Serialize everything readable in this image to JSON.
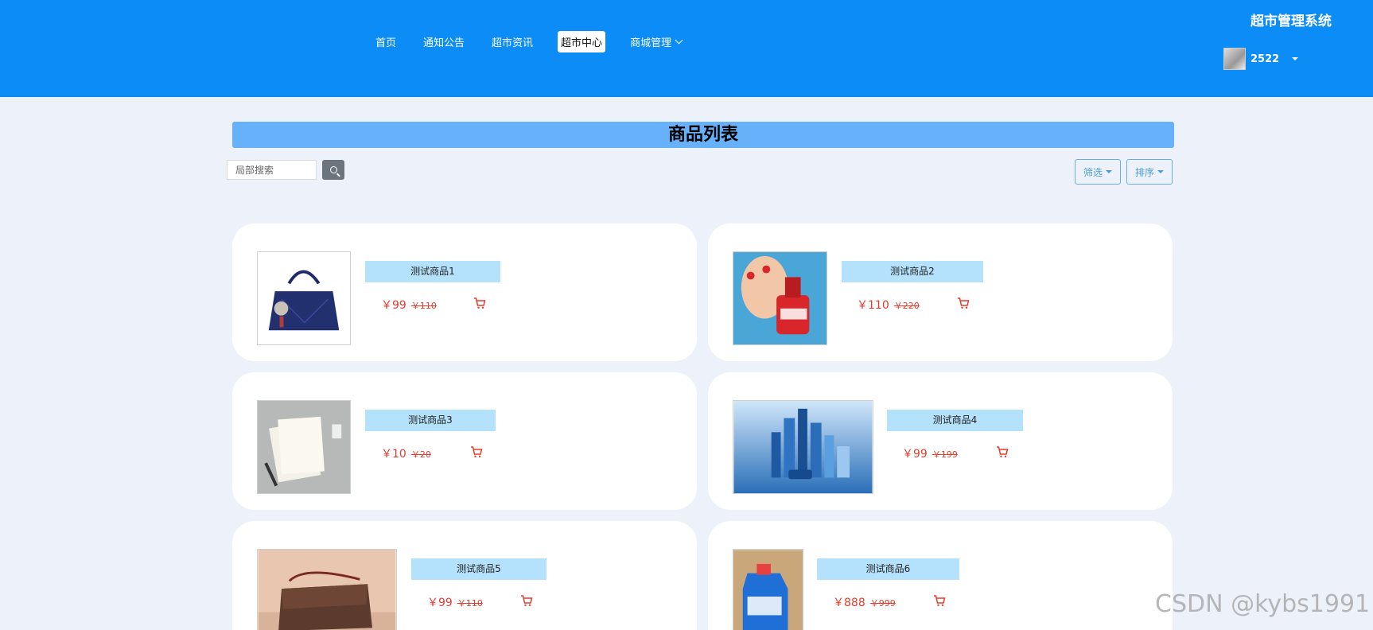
{
  "header": {
    "nav": [
      {
        "label": "首页",
        "active": false
      },
      {
        "label": "通知公告",
        "active": false
      },
      {
        "label": "超市资讯",
        "active": false
      },
      {
        "label": "超市中心",
        "active": true
      },
      {
        "label": "商城管理",
        "active": false,
        "dropdown": true
      }
    ],
    "system_title": "超市管理系统",
    "user": {
      "name": "2522"
    }
  },
  "main": {
    "title": "商品列表",
    "search": {
      "placeholder": "局部搜索",
      "value": ""
    },
    "filter_label": "筛选",
    "sort_label": "排序",
    "products": [
      {
        "name": "测试商品1",
        "price": "￥99",
        "original_price": "￥110",
        "image": "blue-handbag"
      },
      {
        "name": "测试商品2",
        "price": "￥110",
        "original_price": "￥220",
        "image": "red-nail-polish"
      },
      {
        "name": "测试商品3",
        "price": "￥10",
        "original_price": "￥20",
        "image": "notebooks"
      },
      {
        "name": "测试商品4",
        "price": "￥99",
        "original_price": "￥199",
        "image": "blue-skincare-set"
      },
      {
        "name": "测试商品5",
        "price": "￥99",
        "original_price": "￥110",
        "image": "brown-shoulder-bag"
      },
      {
        "name": "测试商品6",
        "price": "￥888",
        "original_price": "￥999",
        "image": "laundry-detergent"
      }
    ]
  },
  "watermark": "CSDN @kybs1991",
  "colors": {
    "header": "#0b8cf7",
    "title_bar": "#67b0fa",
    "name_tag": "#b4e1fb",
    "price": "#e53b2c",
    "background": "#edf2fa"
  }
}
